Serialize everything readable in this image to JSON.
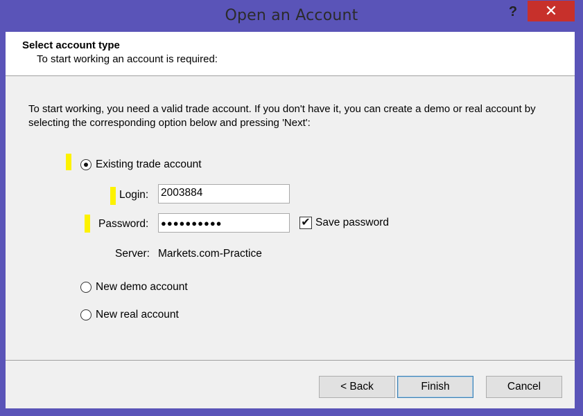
{
  "window": {
    "title": "Open an Account",
    "help_label": "?",
    "close_label": "✕"
  },
  "header": {
    "title": "Select account type",
    "subtitle": "To start working an account is required:"
  },
  "instructions": "To start working, you need a valid trade account. If you don't have it, you can create a demo or real account by selecting the corresponding option below and pressing 'Next':",
  "options": {
    "existing": "Existing trade account",
    "demo": "New demo account",
    "real": "New real account"
  },
  "fields": {
    "login_label": "Login:",
    "login_value": "2003884",
    "password_label": "Password:",
    "password_value": "●●●●●●●●●●",
    "save_password_label": "Save password",
    "server_label": "Server:",
    "server_value": "Markets.com-Practice"
  },
  "buttons": {
    "back": "< Back",
    "finish": "Finish",
    "cancel": "Cancel"
  },
  "colors": {
    "titlebar": "#5a54b8",
    "close": "#c7302b",
    "highlight_marker": "#fdf200"
  }
}
